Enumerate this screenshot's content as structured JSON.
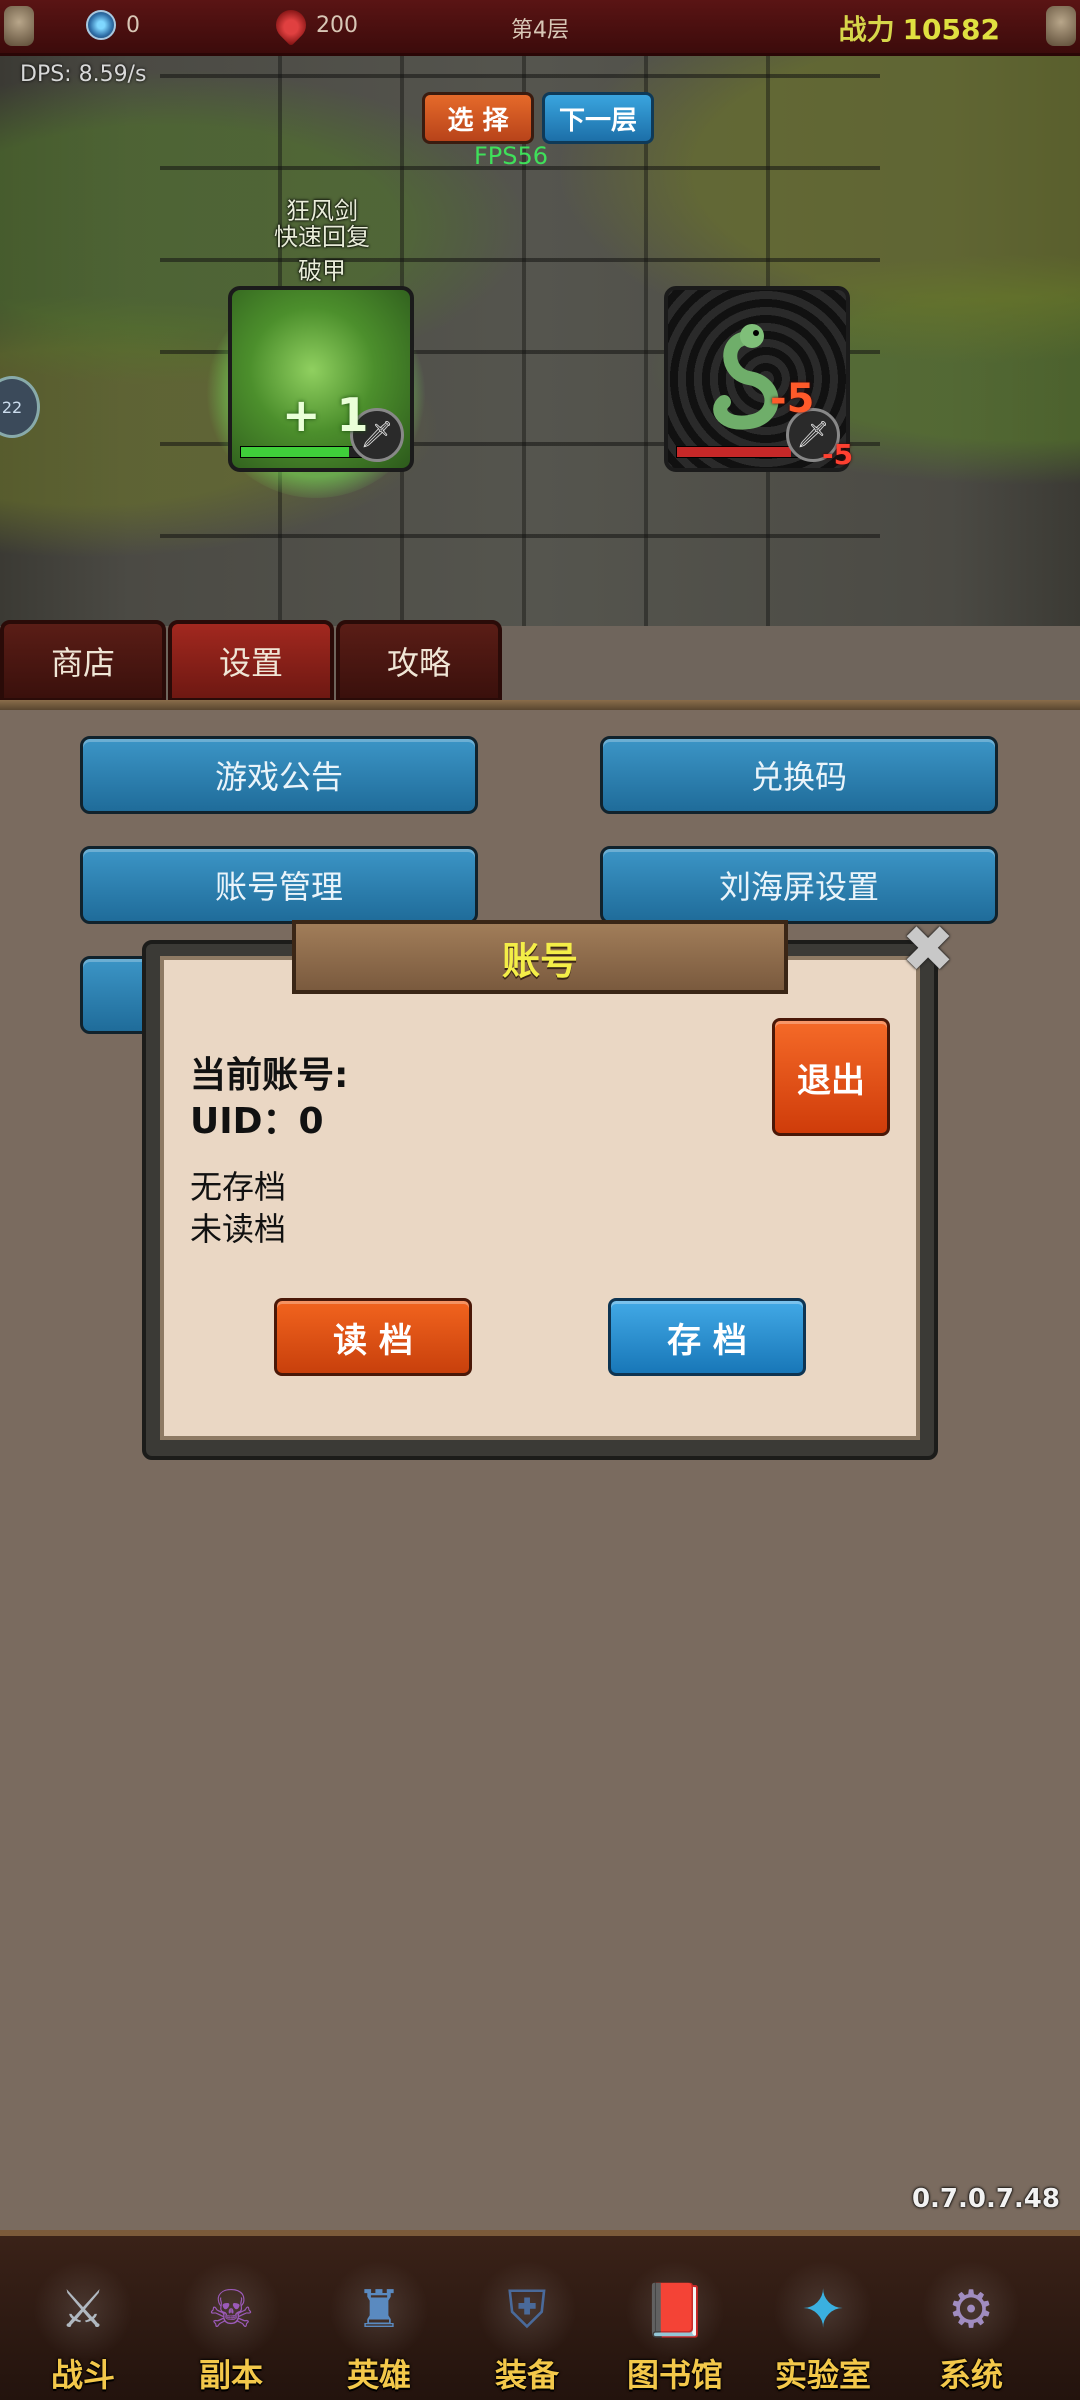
{
  "topbar": {
    "gems": "0",
    "blood": "200",
    "floor": "第4层",
    "power_label": "战力",
    "power_value": "10582"
  },
  "battle": {
    "dps": "DPS: 8.59/s",
    "select_button": "选 择",
    "next_button": "下一层",
    "fps": "FPS56",
    "buffs": [
      "狂风剑",
      "快速回复",
      "破甲"
    ],
    "heal_popup": "+ 1",
    "damage_popup": "-5",
    "damage_popup_small": "-5",
    "hero_hp_fraction": 0.9,
    "enemy_hp_fraction": 0.95,
    "side_bubble": "22"
  },
  "tabs": [
    {
      "label": "商店"
    },
    {
      "label": "设置"
    },
    {
      "label": "攻略"
    }
  ],
  "settings": {
    "buttons": [
      {
        "label": "游戏公告"
      },
      {
        "label": "兑换码"
      },
      {
        "label": "账号管理"
      },
      {
        "label": "刘海屏设置"
      }
    ]
  },
  "account_dialog": {
    "title": "账号",
    "current_account_label": "当前账号:",
    "uid": "UID：0",
    "save_status": "无存档",
    "load_status": "未读档",
    "logout_button": "退出",
    "load_button": "读 档",
    "save_button": "存 档"
  },
  "version": "0.7.0.7.48",
  "bottom_nav": [
    {
      "label": "战斗",
      "icon": "crossed-swords-icon",
      "glyph": "⚔",
      "color": "#b0b8c0"
    },
    {
      "label": "副本",
      "icon": "demon-skull-icon",
      "glyph": "☠",
      "color": "#9b5ab8"
    },
    {
      "label": "英雄",
      "icon": "knight-helmet-icon",
      "glyph": "♜",
      "color": "#5a8ac0"
    },
    {
      "label": "装备",
      "icon": "armor-icon",
      "glyph": "⛨",
      "color": "#4a6a9a"
    },
    {
      "label": "图书馆",
      "icon": "book-icon",
      "glyph": "📕",
      "color": "#b03030"
    },
    {
      "label": "实验室",
      "icon": "crystal-icon",
      "glyph": "✦",
      "color": "#3ab0e0"
    },
    {
      "label": "系统",
      "icon": "gear-icon",
      "glyph": "⚙",
      "color": "#a08cc0"
    }
  ]
}
